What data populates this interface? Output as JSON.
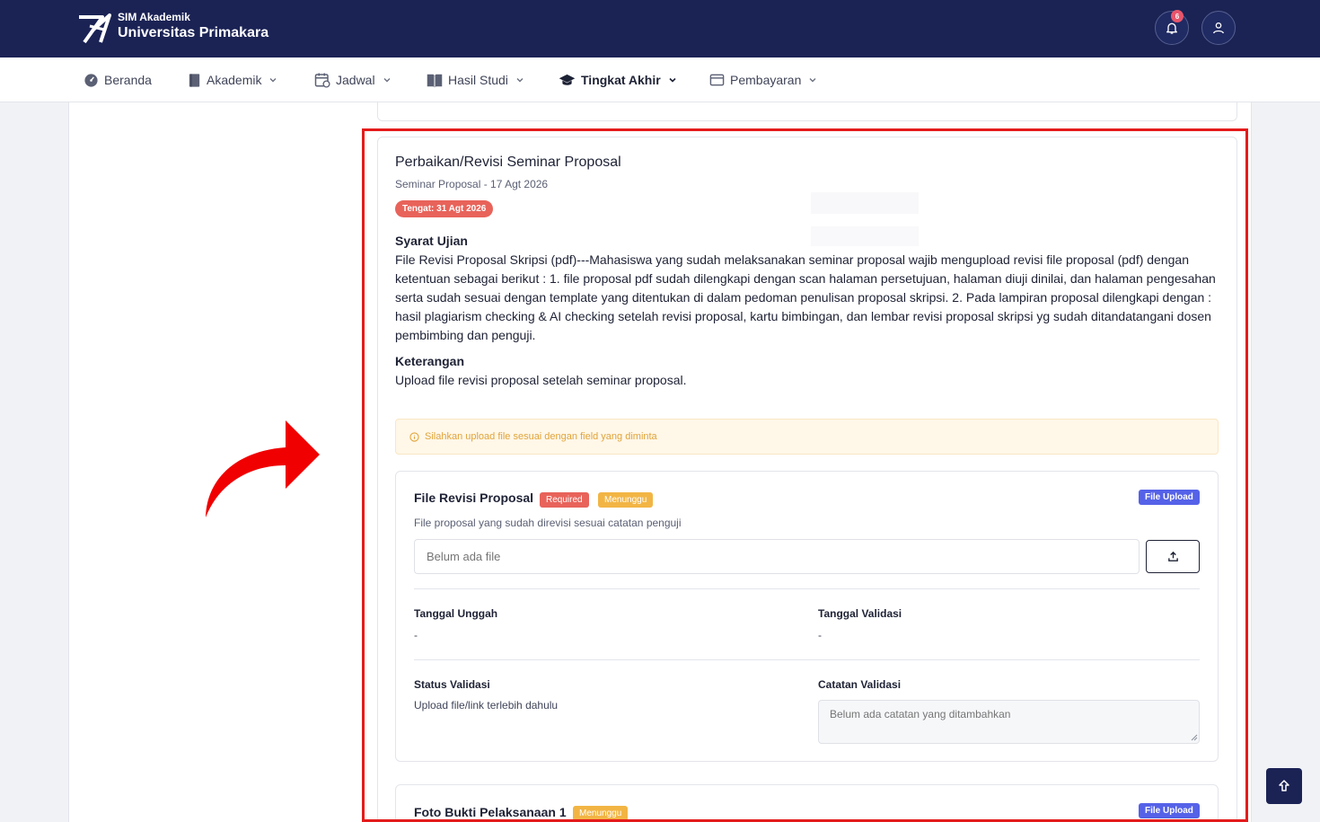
{
  "header": {
    "app_name": "SIM Akademik",
    "university": "Universitas Primakara",
    "notification_count": "6"
  },
  "nav": {
    "items": [
      {
        "label": "Beranda",
        "icon": "dashboard-icon",
        "dropdown": false
      },
      {
        "label": "Akademik",
        "icon": "book-icon",
        "dropdown": true
      },
      {
        "label": "Jadwal",
        "icon": "calendar-icon",
        "dropdown": true
      },
      {
        "label": "Hasil Studi",
        "icon": "open-book-icon",
        "dropdown": true
      },
      {
        "label": "Tingkat Akhir",
        "icon": "graduation-cap-icon",
        "dropdown": true,
        "active": true
      },
      {
        "label": "Pembayaran",
        "icon": "wallet-icon",
        "dropdown": true
      }
    ]
  },
  "card": {
    "title": "Perbaikan/Revisi Seminar Proposal",
    "subtitle": "Seminar Proposal - 17 Agt 2026",
    "deadline": "Tengat: 31 Agt 2026",
    "syarat_heading": "Syarat Ujian",
    "syarat_text": "File Revisi Proposal Skripsi (pdf)---Mahasiswa yang sudah melaksanakan seminar proposal wajib mengupload revisi file proposal (pdf) dengan ketentuan sebagai berikut : 1. file proposal pdf sudah dilengkapi dengan scan halaman persetujuan, halaman diuji dinilai, dan halaman pengesahan serta sudah sesuai dengan template yang ditentukan di dalam pedoman penulisan proposal skripsi. 2. Pada lampiran proposal dilengkapi dengan : hasil plagiarism checking & AI checking setelah revisi proposal, kartu bimbingan, dan lembar revisi proposal skripsi yg sudah ditandatangani dosen pembimbing dan penguji.",
    "keterangan_heading": "Keterangan",
    "keterangan_text": "Upload file revisi proposal setelah seminar proposal.",
    "alert": "Silahkan upload file sesuai dengan field yang diminta"
  },
  "field1": {
    "title": "File Revisi Proposal",
    "required_tag": "Required",
    "status_tag": "Menunggu",
    "type_tag": "File Upload",
    "description": "File proposal yang sudah direvisi sesuai catatan penguji",
    "file_placeholder": "Belum ada file",
    "tanggal_unggah_label": "Tanggal Unggah",
    "tanggal_unggah_value": "-",
    "tanggal_validasi_label": "Tanggal Validasi",
    "tanggal_validasi_value": "-",
    "status_validasi_label": "Status Validasi",
    "status_validasi_value": "Upload file/link terlebih dahulu",
    "catatan_label": "Catatan Validasi",
    "catatan_placeholder": "Belum ada catatan yang ditambahkan"
  },
  "field2": {
    "title": "Foto Bukti Pelaksanaan 1",
    "status_tag": "Menunggu",
    "type_tag": "File Upload"
  },
  "colors": {
    "header_bg": "#1b2355",
    "highlight": "#e41b1b",
    "required": "#e8635a",
    "waiting": "#f2b544",
    "upload_tag": "#5562e8"
  }
}
